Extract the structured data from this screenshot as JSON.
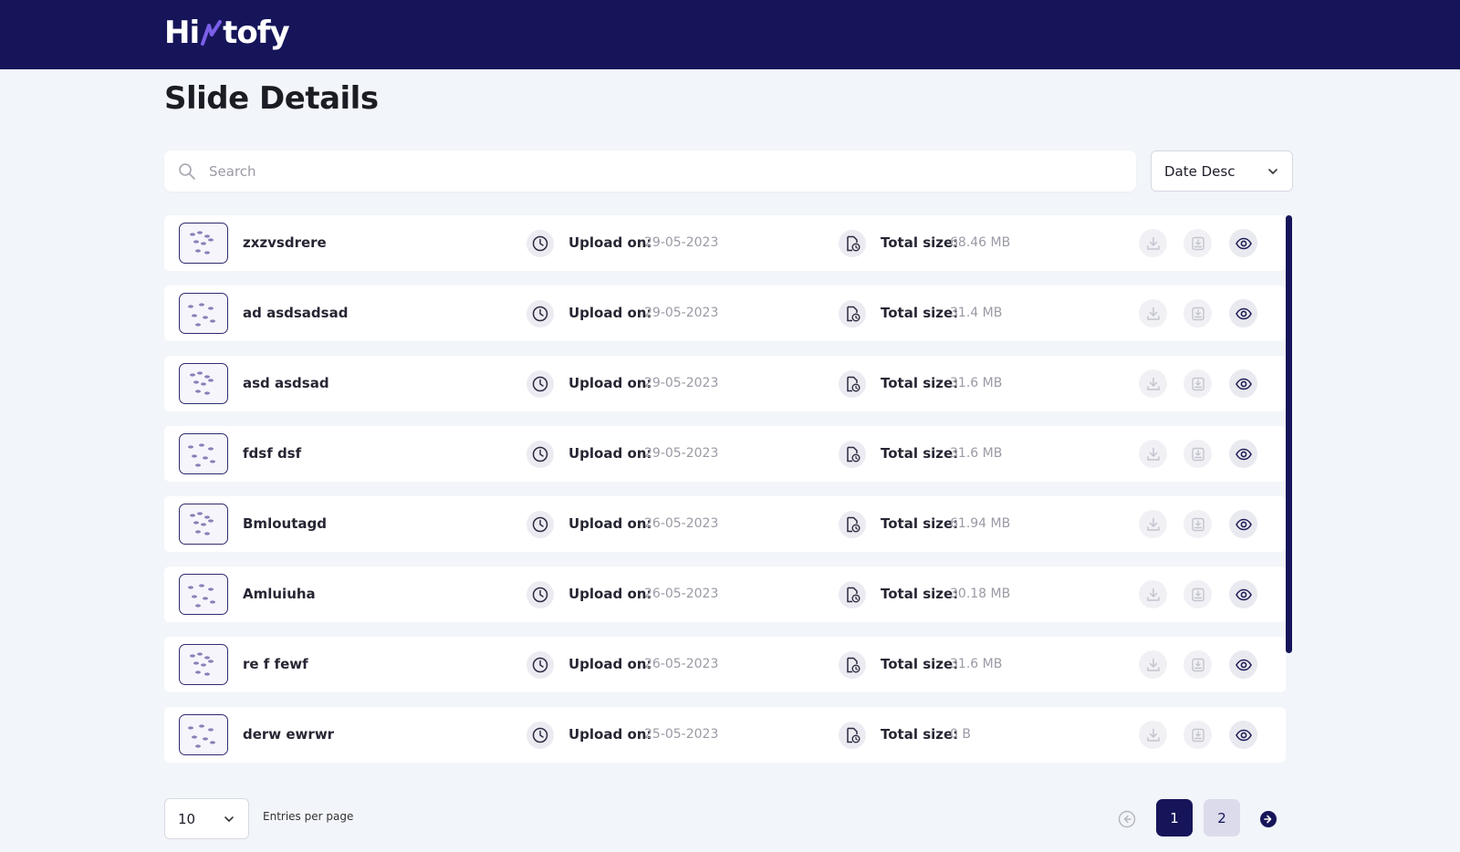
{
  "app": {
    "logo_left": "Hi",
    "logo_right": "tofy",
    "brand_color": "#16155a"
  },
  "page": {
    "title": "Slide Details"
  },
  "search": {
    "placeholder": "Search",
    "value": ""
  },
  "sort": {
    "selected": "Date Desc"
  },
  "labels": {
    "upload_on": "Upload on:",
    "total_size": "Total size:"
  },
  "slides": [
    {
      "name": "zxzvsdrere",
      "upload_date": "29-05-2023",
      "size": "68.46 MB"
    },
    {
      "name": "ad asdsadsad",
      "upload_date": "29-05-2023",
      "size": "31.4 MB"
    },
    {
      "name": "asd asdsad",
      "upload_date": "29-05-2023",
      "size": "31.6 MB"
    },
    {
      "name": "fdsf dsf",
      "upload_date": "29-05-2023",
      "size": "31.6 MB"
    },
    {
      "name": "Bmloutagd",
      "upload_date": "26-05-2023",
      "size": "61.94 MB"
    },
    {
      "name": "Amluiuha",
      "upload_date": "26-05-2023",
      "size": "30.18 MB"
    },
    {
      "name": "re f fewf",
      "upload_date": "26-05-2023",
      "size": "31.6 MB"
    },
    {
      "name": "derw ewrwr",
      "upload_date": "25-05-2023",
      "size": "0 B"
    }
  ],
  "pagination": {
    "per_page": "10",
    "per_page_label": "Entries per page",
    "pages": [
      "1",
      "2"
    ],
    "current": "1"
  },
  "icons": {
    "search": "search-icon",
    "clock": "clock-icon",
    "file_size": "file-clock-icon",
    "download": "download-icon",
    "report": "report-download-icon",
    "view": "eye-icon",
    "chevron": "chevron-down-icon"
  }
}
